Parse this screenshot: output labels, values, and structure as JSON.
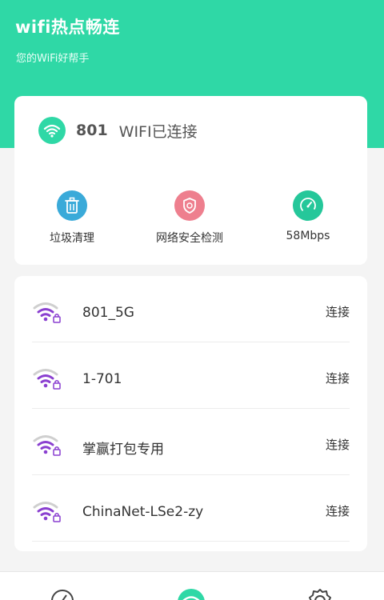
{
  "header": {
    "title": "wifi热点畅连",
    "subtitle": "您的WiFi好帮手"
  },
  "status": {
    "ssid": "801",
    "state": "WIFI已连接"
  },
  "tools": [
    {
      "label": "垃圾清理",
      "icon": "trash-icon"
    },
    {
      "label": "网络安全检测",
      "icon": "shield-icon"
    },
    {
      "label": "58Mbps",
      "icon": "speedometer-icon"
    }
  ],
  "networks": [
    {
      "name": "801_5G",
      "action": "连接"
    },
    {
      "name": "1-701",
      "action": "连接"
    },
    {
      "name": "掌赢打包专用",
      "action": "连接"
    },
    {
      "name": "ChinaNet-LSe2-zy",
      "action": "连接"
    }
  ],
  "colors": {
    "brand": "#2fd8a6",
    "wifi_locked": "#8a3fd0",
    "clean": "#3aaad9",
    "security": "#ee7f8e"
  }
}
